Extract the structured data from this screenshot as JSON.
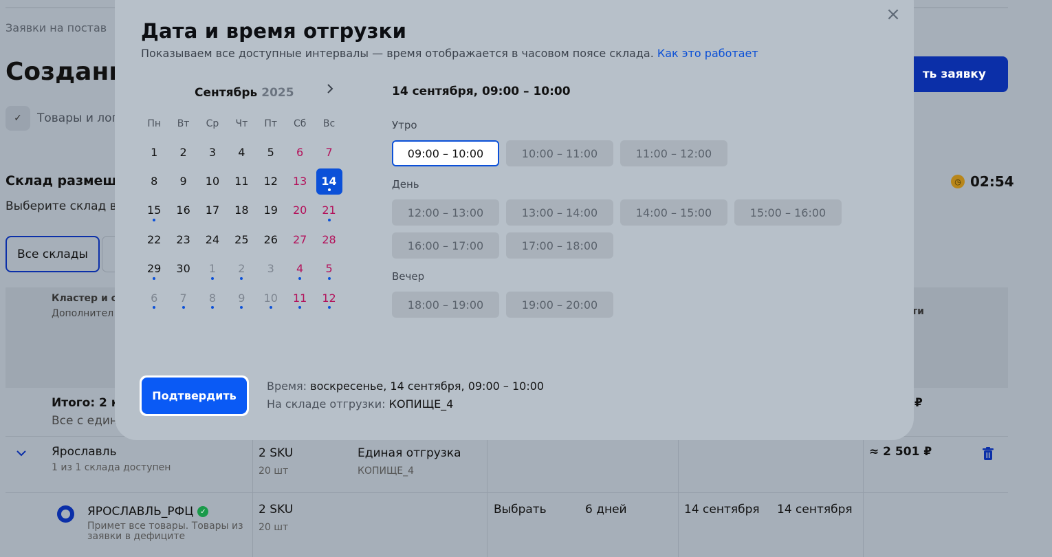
{
  "background": {
    "breadcrumb": "Заявки на постав",
    "title": "Создани",
    "create_button": "ть заявку",
    "step_label": "Товары и лог",
    "warehouse_title": "Склад размещен",
    "timer": "02:54",
    "warehouse_sub": "Выберите склад в",
    "tab_all": "Все склады",
    "table": {
      "col1_header": "Кластер и ск",
      "col1_sub": "Дополнител",
      "right_header": "ти",
      "total_label": "Итого: 2 кл",
      "total_sub": "Все с един",
      "total_price": "₽",
      "city_row": {
        "city": "Ярославль",
        "city_sub": "1 из 1 склада доступен",
        "sku": "2 SKU",
        "qty": "20 шт",
        "shipment": "Единая отгрузка",
        "shipment_sub": "КОПИЩЕ_4",
        "price": "≈ 2 501 ₽"
      },
      "warehouse_row": {
        "name": "ЯРОСЛАВЛЬ_РФЦ",
        "desc": "Примет все товары. Товары из заявки в дефиците",
        "sku": "2 SKU",
        "qty": "20 шт",
        "choose": "Выбрать",
        "days": "6 дней",
        "date1": "14 сентября",
        "date2": "14 сентября"
      }
    }
  },
  "modal": {
    "title": "Дата и время отгрузки",
    "subtitle": "Показываем все доступные интервалы — время отображается в часовом поясе склада.",
    "help_link": "Как это работает",
    "close_icon": "×",
    "calendar": {
      "month": "Сентябрь",
      "year": "2025",
      "weekdays": [
        "Пн",
        "Вт",
        "Ср",
        "Чт",
        "Пт",
        "Сб",
        "Вс"
      ],
      "weeks": [
        [
          {
            "d": "1"
          },
          {
            "d": "2"
          },
          {
            "d": "3"
          },
          {
            "d": "4"
          },
          {
            "d": "5"
          },
          {
            "d": "6",
            "we": true
          },
          {
            "d": "7",
            "we": true
          }
        ],
        [
          {
            "d": "8"
          },
          {
            "d": "9"
          },
          {
            "d": "10"
          },
          {
            "d": "11"
          },
          {
            "d": "12"
          },
          {
            "d": "13",
            "we": true
          },
          {
            "d": "14",
            "we": true,
            "sel": true,
            "dot": true
          }
        ],
        [
          {
            "d": "15",
            "dot": true
          },
          {
            "d": "16"
          },
          {
            "d": "17"
          },
          {
            "d": "18"
          },
          {
            "d": "19"
          },
          {
            "d": "20",
            "we": true
          },
          {
            "d": "21",
            "we": true,
            "dot": true
          }
        ],
        [
          {
            "d": "22"
          },
          {
            "d": "23"
          },
          {
            "d": "24"
          },
          {
            "d": "25"
          },
          {
            "d": "26"
          },
          {
            "d": "27",
            "we": true
          },
          {
            "d": "28",
            "we": true
          }
        ],
        [
          {
            "d": "29",
            "dot": true
          },
          {
            "d": "30"
          },
          {
            "d": "1",
            "m": true,
            "dot": true
          },
          {
            "d": "2",
            "m": true,
            "dot": true
          },
          {
            "d": "3",
            "m": true
          },
          {
            "d": "4",
            "m": true,
            "we": true,
            "dot": true
          },
          {
            "d": "5",
            "m": true,
            "we": true,
            "dot": true
          }
        ],
        [
          {
            "d": "6",
            "m": true,
            "dot": true
          },
          {
            "d": "7",
            "m": true,
            "dot": true
          },
          {
            "d": "8",
            "m": true,
            "dot": true
          },
          {
            "d": "9",
            "m": true,
            "dot": true
          },
          {
            "d": "10",
            "m": true,
            "dot": true
          },
          {
            "d": "11",
            "m": true,
            "we": true,
            "dot": true
          },
          {
            "d": "12",
            "m": true,
            "we": true,
            "dot": true
          }
        ]
      ]
    },
    "selected_header": "14 сентября, 09:00 – 10:00",
    "groups": [
      {
        "label": "Утро",
        "slots": [
          "09:00 – 10:00",
          "10:00 – 11:00",
          "11:00 – 12:00"
        ]
      },
      {
        "label": "День",
        "slots": [
          "12:00 – 13:00",
          "13:00 – 14:00",
          "14:00 – 15:00",
          "15:00 – 16:00",
          "16:00 – 17:00",
          "17:00 – 18:00"
        ]
      },
      {
        "label": "Вечер",
        "slots": [
          "18:00 – 19:00",
          "19:00 – 20:00"
        ]
      }
    ],
    "active_slot": "09:00 – 10:00",
    "confirm_button": "Подтвердить",
    "summary": {
      "time_label": "Время:",
      "time_value": "воскресенье, 14 сентября, 09:00 – 10:00",
      "warehouse_label": "На складе отгрузки:",
      "warehouse_value": "КОПИЩЕ_4"
    }
  }
}
